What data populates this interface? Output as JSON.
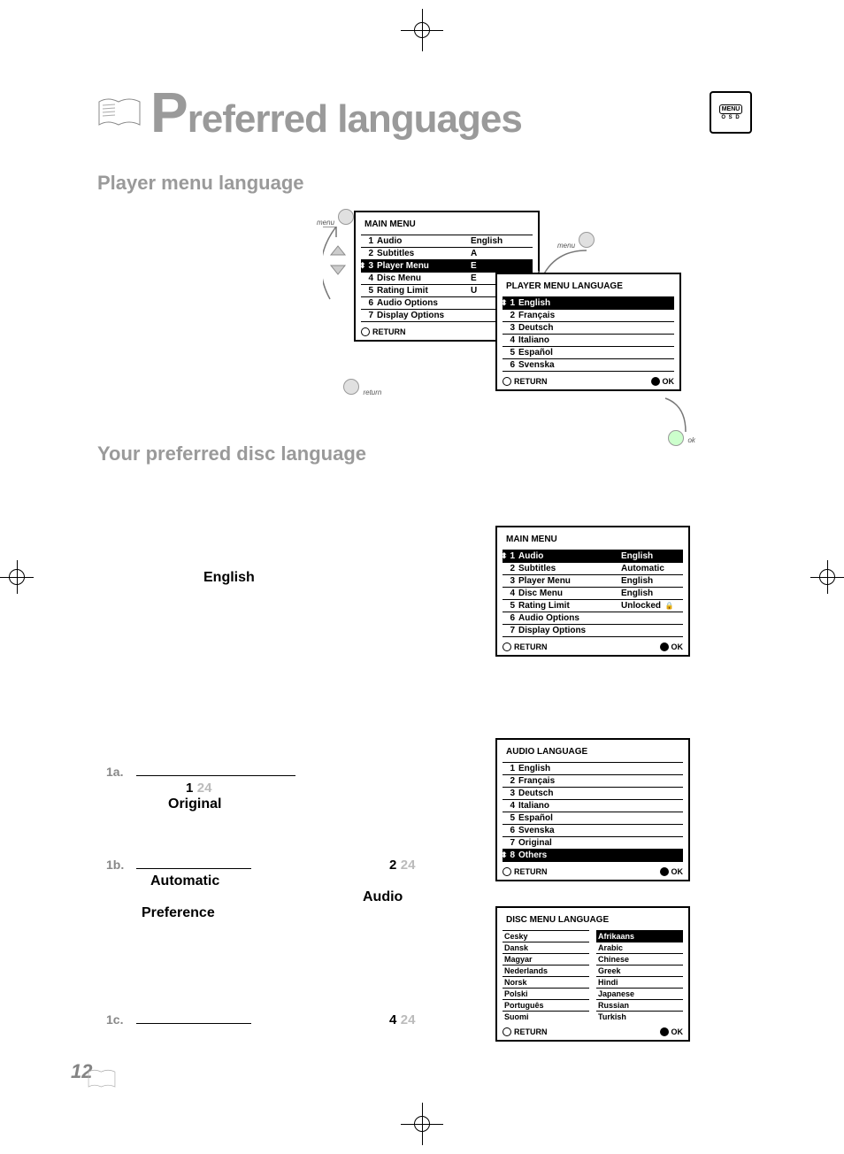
{
  "page_number": "12",
  "title": "Preferred languages",
  "menu_osd_label": "MENU",
  "menu_osd_sub": "O S D",
  "section1_heading": "Player menu language",
  "section2_heading": "Your preferred disc language",
  "remote_labels": {
    "menu": "menu",
    "return": "return",
    "ok": "ok"
  },
  "main_menu": {
    "title": "MAIN MENU",
    "rows": [
      {
        "n": "1",
        "label": "Audio",
        "val": "English"
      },
      {
        "n": "2",
        "label": "Subtitles",
        "val": "A"
      },
      {
        "n": "3",
        "label": "Player Menu",
        "val": "E",
        "sel": true
      },
      {
        "n": "4",
        "label": "Disc Menu",
        "val": "E"
      },
      {
        "n": "5",
        "label": "Rating Limit",
        "val": "U"
      },
      {
        "n": "6",
        "label": "Audio Options",
        "val": ""
      },
      {
        "n": "7",
        "label": "Display Options",
        "val": ""
      }
    ],
    "return": "RETURN"
  },
  "player_menu_lang": {
    "title": "PLAYER MENU LANGUAGE",
    "rows": [
      {
        "n": "1",
        "label": "English",
        "sel": true
      },
      {
        "n": "2",
        "label": "Français"
      },
      {
        "n": "3",
        "label": "Deutsch"
      },
      {
        "n": "4",
        "label": "Italiano"
      },
      {
        "n": "5",
        "label": "Español"
      },
      {
        "n": "6",
        "label": "Svenska"
      }
    ],
    "return": "RETURN",
    "ok": "OK"
  },
  "body_word_english": "English",
  "main_menu2": {
    "title": "MAIN MENU",
    "rows": [
      {
        "n": "1",
        "label": "Audio",
        "val": "English",
        "sel": true
      },
      {
        "n": "2",
        "label": "Subtitles",
        "val": "Automatic"
      },
      {
        "n": "3",
        "label": "Player Menu",
        "val": "English"
      },
      {
        "n": "4",
        "label": "Disc Menu",
        "val": "English"
      },
      {
        "n": "5",
        "label": "Rating Limit",
        "val": "Unlocked",
        "lock": true
      },
      {
        "n": "6",
        "label": "Audio Options",
        "val": ""
      },
      {
        "n": "7",
        "label": "Display Options",
        "val": ""
      }
    ],
    "return": "RETURN",
    "ok": "OK"
  },
  "audio_lang": {
    "title": "AUDIO LANGUAGE",
    "rows": [
      {
        "n": "1",
        "label": "English"
      },
      {
        "n": "2",
        "label": "Français"
      },
      {
        "n": "3",
        "label": "Deutsch"
      },
      {
        "n": "4",
        "label": "Italiano"
      },
      {
        "n": "5",
        "label": "Español"
      },
      {
        "n": "6",
        "label": "Svenska"
      },
      {
        "n": "7",
        "label": "Original"
      },
      {
        "n": "8",
        "label": "Others",
        "sel": true
      }
    ],
    "return": "RETURN",
    "ok": "OK"
  },
  "disc_menu_lang": {
    "title": "DISC MENU LANGUAGE",
    "left": [
      "Cesky",
      "Dansk",
      "Magyar",
      "Nederlands",
      "Norsk",
      "Polski",
      "Português",
      "Suomi"
    ],
    "right": [
      "Afrikaans",
      "Arabic",
      "Chinese",
      "Greek",
      "Hindi",
      "Japanese",
      "Russian",
      "Turkish"
    ],
    "sel": "Afrikaans",
    "return": "RETURN",
    "ok": "OK"
  },
  "steps": {
    "s1a": {
      "lbl": "1a.",
      "num": "1",
      "ghost": "24",
      "word": "Original"
    },
    "s1b": {
      "lbl": "1b.",
      "word1": "Automatic",
      "word2": "Preference"
    },
    "s2": {
      "num": "2",
      "ghost": "24",
      "word": "Audio"
    },
    "s1c": {
      "lbl": "1c."
    },
    "s4": {
      "num": "4",
      "ghost": "24"
    }
  }
}
